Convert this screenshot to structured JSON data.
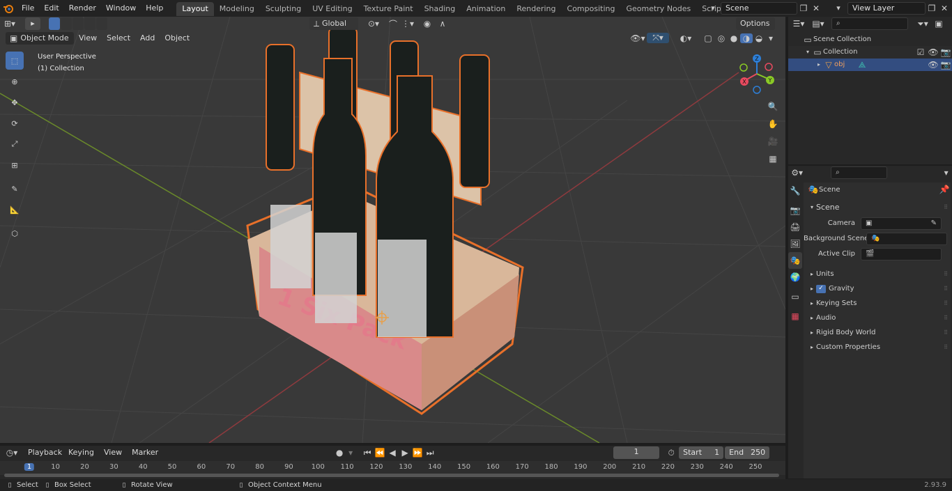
{
  "topbar": {
    "menus": [
      "File",
      "Edit",
      "Render",
      "Window",
      "Help"
    ],
    "workspaces": [
      "Layout",
      "Modeling",
      "Sculpting",
      "UV Editing",
      "Texture Paint",
      "Shading",
      "Animation",
      "Rendering",
      "Compositing",
      "Geometry Nodes",
      "Scripting"
    ],
    "scene": "Scene",
    "view_layer": "View Layer"
  },
  "viewport": {
    "mode": "Object Mode",
    "menus": [
      "View",
      "Select",
      "Add",
      "Object"
    ],
    "transform_orientation": "Global",
    "options": "Options",
    "overlay_title": "User Perspective",
    "overlay_subtitle": "(1) Collection",
    "gizmo_axes": {
      "z": "Z",
      "y": "Y",
      "x": "X"
    },
    "label_text": "1 Six Pack",
    "colors": {
      "bg": "#3a3a3a",
      "grid": "#474747",
      "x_axis": "#8e3a3e",
      "y_axis": "#6a8a2a",
      "selection": "#e8702a"
    }
  },
  "tools": [
    "select-box",
    "cursor",
    "move",
    "rotate",
    "scale",
    "transform",
    "annotate",
    "measure",
    "add-cube"
  ],
  "outliner": {
    "scene_collection": "Scene Collection",
    "collection": "Collection",
    "object": "obj"
  },
  "properties": {
    "context": "Scene",
    "panel": "Scene",
    "fields": [
      {
        "label": "Camera",
        "value": ""
      },
      {
        "label": "Background Scene",
        "value": ""
      },
      {
        "label": "Active Clip",
        "value": ""
      }
    ],
    "sections": [
      "Units",
      "Gravity",
      "Keying Sets",
      "Audio",
      "Rigid Body World",
      "Custom Properties"
    ]
  },
  "timeline": {
    "menus": [
      "Playback",
      "Keying",
      "View",
      "Marker"
    ],
    "current_frame": "1",
    "start_label": "Start",
    "start": "1",
    "end_label": "End",
    "end": "250",
    "ruler": [
      "1",
      "10",
      "20",
      "30",
      "40",
      "50",
      "60",
      "70",
      "80",
      "90",
      "100",
      "110",
      "120",
      "130",
      "140",
      "150",
      "160",
      "170",
      "180",
      "190",
      "200",
      "210",
      "220",
      "230",
      "240",
      "250"
    ]
  },
  "statusbar": {
    "select": "Select",
    "box_select": "Box Select",
    "rotate_view": "Rotate View",
    "context_menu": "Object Context Menu",
    "version": "2.93.9"
  }
}
